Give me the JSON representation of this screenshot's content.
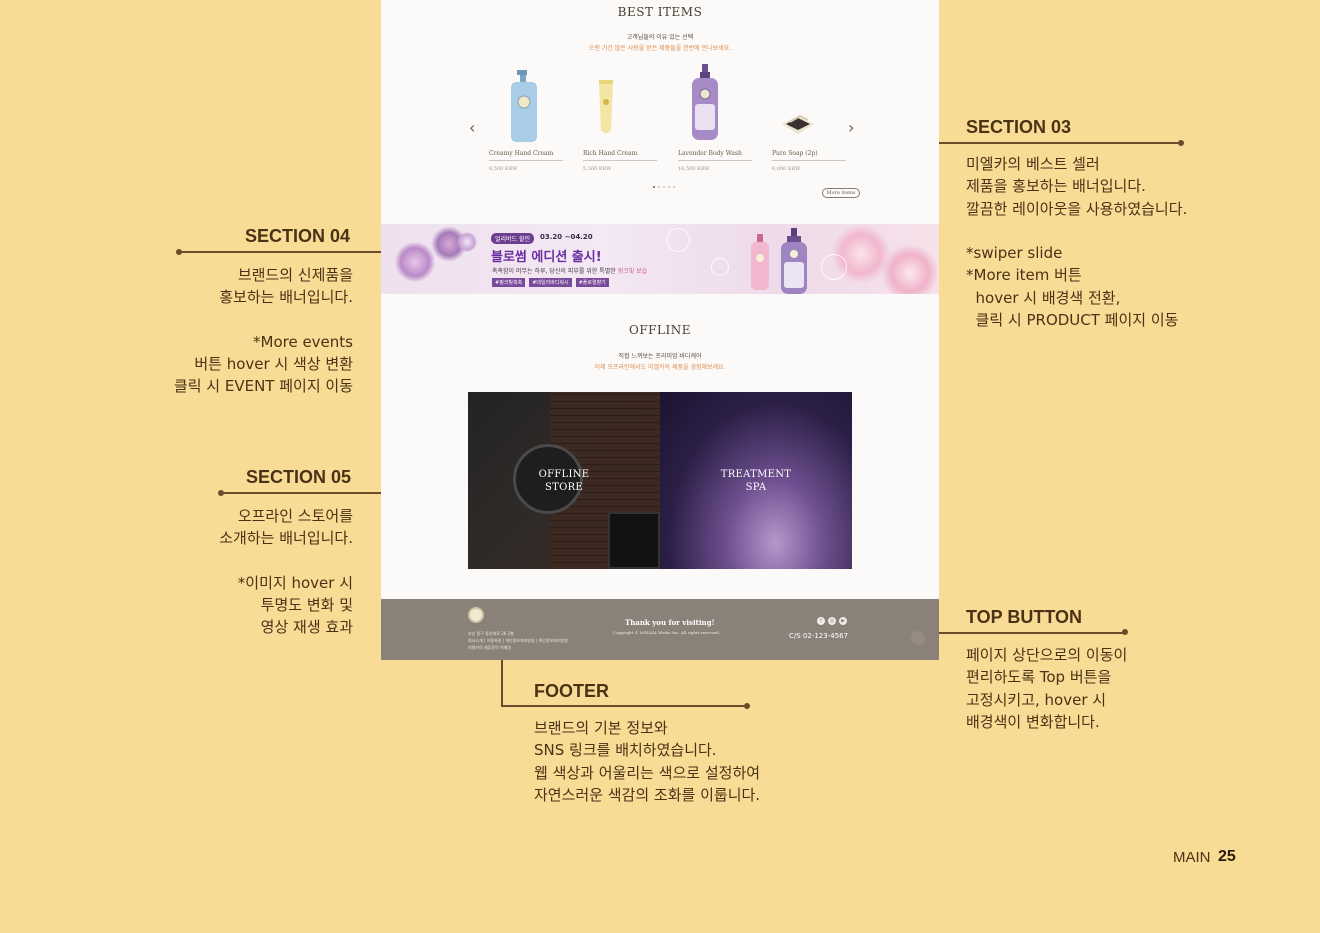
{
  "site": {
    "best": {
      "title": "BEST ITEMS",
      "sub1": "고객님들의 이유 있는 선택",
      "sub2": "오랜 기간 많은 사랑을 받은 제품들을 한번에 만나보세요.",
      "products": [
        {
          "name": "Creamy Hand Cream",
          "price": "8,500 KRW"
        },
        {
          "name": "Rich Hand Cream",
          "price": "5,500 KRW"
        },
        {
          "name": "Lavender Body Wash",
          "price": "16,500 KRW"
        },
        {
          "name": "Pure Soap (2p)",
          "price": "6,000 KRW"
        }
      ],
      "more_label": "More items"
    },
    "event": {
      "badge": "얼리버드 할인",
      "date": "03.20 ~04.20",
      "title": "블로썸 에디션 출시!",
      "desc": "촉촉함이 머무는 하루, 당신의 피부를 위한 특별한",
      "desc_highlight": "핑크빛 보습",
      "tags": [
        "#핑크빛촉촉",
        "#데일리바디워시",
        "#플로럴향기"
      ]
    },
    "offline": {
      "title": "OFFLINE",
      "sub1": "직접 느껴보는 프리미엄 바디케어",
      "sub2": "이제 오프라인에서도 미엘카의 제품을 경험해보세요.",
      "store_label_1": "OFFLINE",
      "store_label_2": "STORE",
      "spa_label_1": "TREATMENT",
      "spa_label_2": "SPA"
    },
    "footer": {
      "address_1": "부산 중구 중앙대로 26 2층",
      "address_2": "회사소개 | 이용약관 | 개인정보처리방침 | 개인정보처리방침",
      "address_3": "미엘카의 제휴문의 이메일",
      "thanks": "Thank you for visiting!",
      "copyright": "Copyright © MIELKA Works Inc. All rights reserved.",
      "cs": "C/S 02-123-4567",
      "sns": [
        "f",
        "◎",
        "▶"
      ]
    }
  },
  "annotations": {
    "s03": {
      "title": "SECTION 03",
      "text": "미엘카의 베스트 셀러\n제품을 홍보하는 배너입니다.\n깔끔한 레이아웃을 사용하였습니다.\n\n*swiper slide\n*More item 버튼\n  hover 시 배경색 전환,\n  클릭 시 PRODUCT 페이지 이동"
    },
    "s04": {
      "title": "SECTION 04",
      "text": "브랜드의 신제품을\n홍보하는 배너입니다.\n\n*More events\n버튼 hover 시 색상 변환\n클릭 시 EVENT 페이지 이동"
    },
    "s05": {
      "title": "SECTION 05",
      "text": "오프라인 스토어를\n소개하는 배너입니다.\n\n*이미지 hover 시\n투명도 변화 및\n영상 재생 효과"
    },
    "top": {
      "title": "TOP BUTTON",
      "text": "페이지 상단으로의 이동이\n편리하도록 Top 버튼을\n고정시키고, hover 시\n배경색이 변화합니다."
    },
    "footer": {
      "title": "FOOTER",
      "text": "브랜드의 기본 정보와\nSNS 링크를 배치하였습니다.\n웹 색상과 어울리는 색으로 설정하여\n자연스러운 색감의 조화를 이룹니다."
    }
  },
  "page": {
    "label": "MAIN",
    "number": "25"
  },
  "colors": {
    "background": "#f8db94",
    "accent_orange": "#e18b4c",
    "footer": "#8a8178",
    "event_purple": "#6b2ea0"
  }
}
